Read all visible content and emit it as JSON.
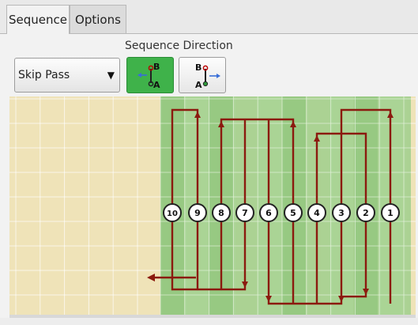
{
  "tabs": [
    {
      "label": "Sequence",
      "active": true
    },
    {
      "label": "Options",
      "active": false
    }
  ],
  "sequence_direction": {
    "label": "Sequence Direction",
    "pattern_select": {
      "value": "Skip Pass"
    },
    "buttons": [
      {
        "name": "direction-a-to-b",
        "top_letter": "B",
        "bottom_letter": "A",
        "active": true
      },
      {
        "name": "direction-b-to-a",
        "top_letter": "B",
        "bottom_letter": "A",
        "active": false
      }
    ]
  },
  "pass_labels": [
    "10",
    "9",
    "8",
    "7",
    "6",
    "5",
    "4",
    "3",
    "2",
    "1"
  ],
  "colors": {
    "accent_green": "#3fb24a",
    "path_red": "#8b1a0f",
    "background_grid": "#efe3b8",
    "pass_zone": "#9fcf8c"
  }
}
